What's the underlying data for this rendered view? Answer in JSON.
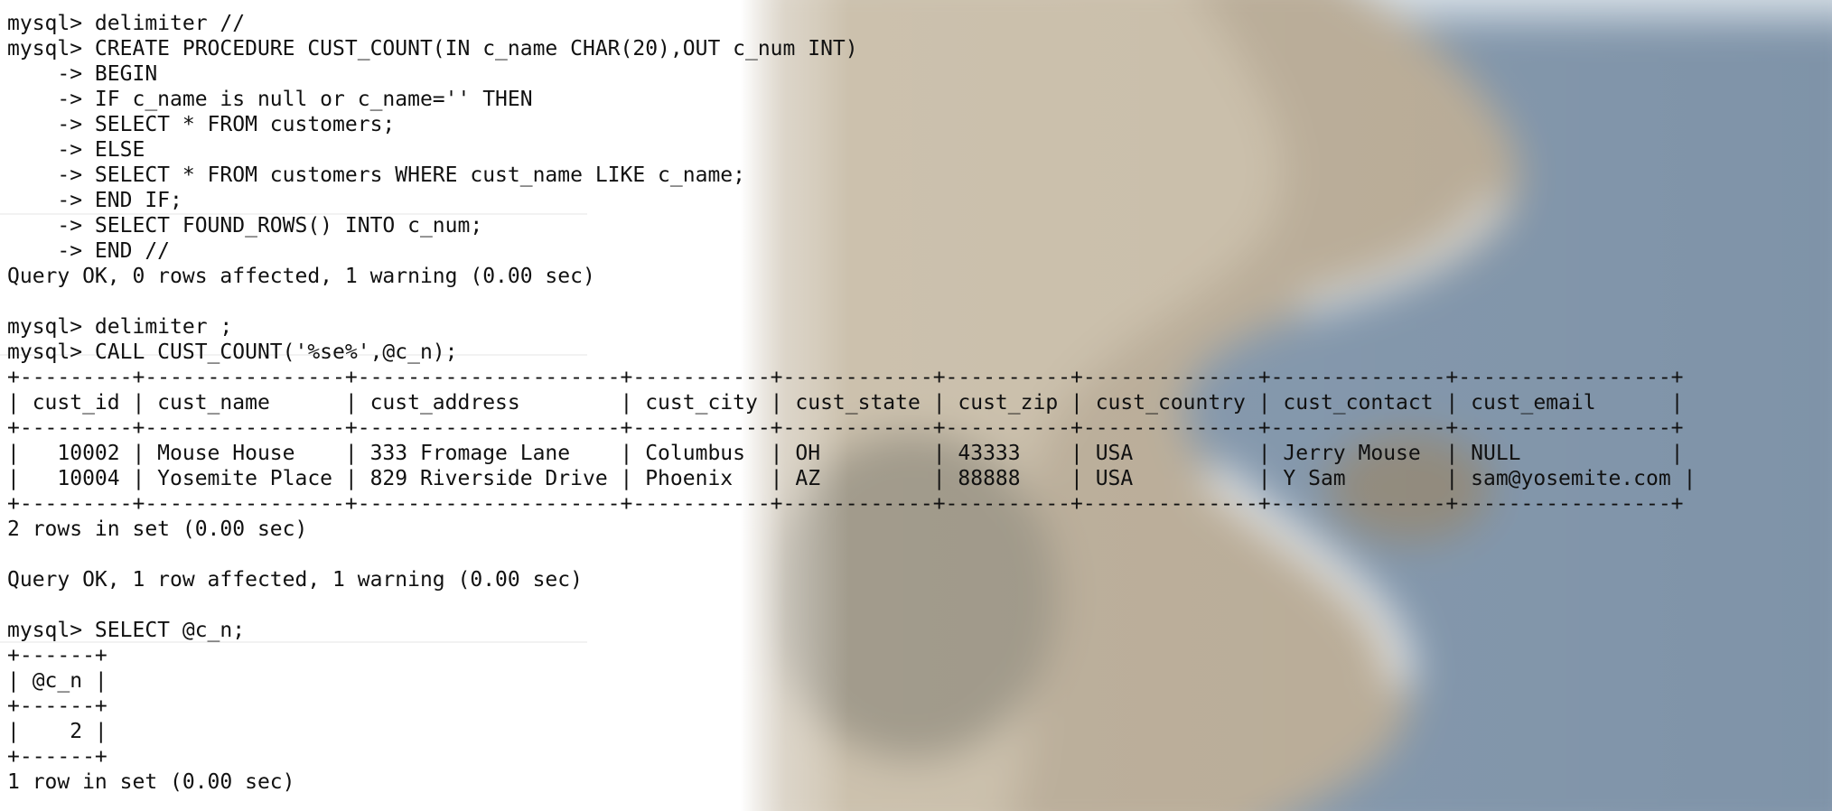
{
  "terminal": {
    "lines": [
      "mysql> delimiter //",
      "mysql> CREATE PROCEDURE CUST_COUNT(IN c_name CHAR(20),OUT c_num INT)",
      "    -> BEGIN",
      "    -> IF c_name is null or c_name='' THEN",
      "    -> SELECT * FROM customers;",
      "    -> ELSE",
      "    -> SELECT * FROM customers WHERE cust_name LIKE c_name;",
      "    -> END IF;",
      "    -> SELECT FOUND_ROWS() INTO c_num;",
      "    -> END //",
      "Query OK, 0 rows affected, 1 warning (0.00 sec)",
      "",
      "mysql> delimiter ;",
      "mysql> CALL CUST_COUNT('%se%',@c_n);",
      "+---------+----------------+---------------------+-----------+------------+----------+--------------+--------------+-----------------+",
      "| cust_id | cust_name      | cust_address        | cust_city | cust_state | cust_zip | cust_country | cust_contact | cust_email      |",
      "+---------+----------------+---------------------+-----------+------------+----------+--------------+--------------+-----------------+",
      "|   10002 | Mouse House    | 333 Fromage Lane    | Columbus  | OH         | 43333    | USA          | Jerry Mouse  | NULL            |",
      "|   10004 | Yosemite Place | 829 Riverside Drive | Phoenix   | AZ         | 88888    | USA          | Y Sam        | sam@yosemite.com |",
      "+---------+----------------+---------------------+-----------+------------+----------+--------------+--------------+-----------------+",
      "2 rows in set (0.00 sec)",
      "",
      "Query OK, 1 row affected, 1 warning (0.00 sec)",
      "",
      "mysql> SELECT @c_n;",
      "+------+",
      "| @c_n |",
      "+------+",
      "|    2 |",
      "+------+",
      "1 row in set (0.00 sec)"
    ]
  },
  "colors": {
    "text": "#111111",
    "background": "#ffffff",
    "sea": "#5b7590",
    "cliff": "#a39277"
  }
}
